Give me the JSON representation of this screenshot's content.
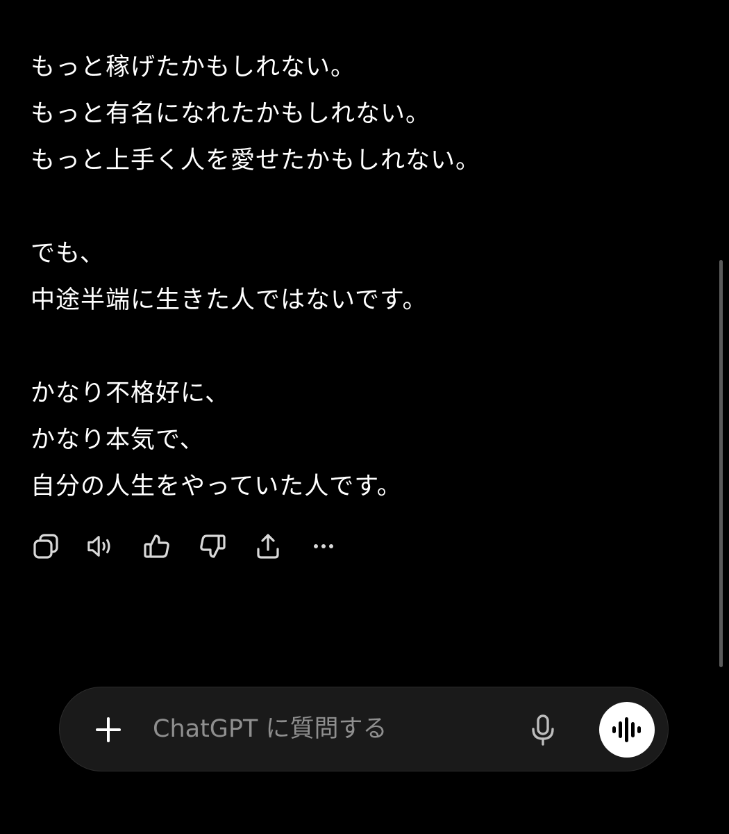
{
  "message": {
    "lines": [
      "もっと稼げたかもしれない。",
      "もっと有名になれたかもしれない。",
      "もっと上手く人を愛せたかもしれない。",
      "",
      "でも、",
      "中途半端に生きた人ではないです。",
      "",
      "かなり不格好に、",
      "かなり本気で、",
      "自分の人生をやっていた人です。"
    ]
  },
  "actions": [
    {
      "icon": "copy-icon"
    },
    {
      "icon": "read-aloud-icon"
    },
    {
      "icon": "thumbs-up-icon"
    },
    {
      "icon": "thumbs-down-icon"
    },
    {
      "icon": "share-icon"
    },
    {
      "icon": "more-icon"
    }
  ],
  "composer": {
    "placeholder": "ChatGPT に質問する",
    "value": "",
    "plus_icon": "plus-icon",
    "mic_icon": "microphone-icon",
    "voice_icon": "voice-mode-icon"
  },
  "colors": {
    "background": "#000000",
    "text": "#ffffff",
    "icon": "#d9d9d9",
    "composer_bg": "#1a1a1a",
    "placeholder": "#8f8f8f"
  }
}
